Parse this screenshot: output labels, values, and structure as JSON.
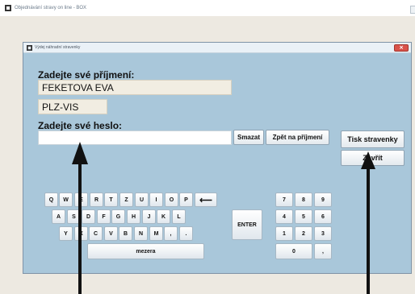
{
  "app": {
    "title": "Objednávání stravy on line - BOX"
  },
  "dialog": {
    "title": "Výdej náhradní stravenky",
    "close_glyph": "×"
  },
  "form": {
    "surname_label": "Zadejte své příjmení:",
    "surname_value": "FEKETOVA EVA",
    "department_value": "PLZ-VIS",
    "password_label": "Zadejte své heslo:",
    "password_value": ""
  },
  "buttons": {
    "clear": "Smazat",
    "back_to_surname": "Zpět na příjmení",
    "print_ticket": "Tisk stravenky",
    "close": "Zavřít"
  },
  "keyboard": {
    "row1": [
      "Q",
      "W",
      "E",
      "R",
      "T",
      "Z",
      "U",
      "I",
      "O",
      "P"
    ],
    "backspace_glyph": "⟵",
    "row2": [
      "A",
      "S",
      "D",
      "F",
      "G",
      "H",
      "J",
      "K",
      "L"
    ],
    "enter": "ENTER",
    "row3": [
      "Y",
      "X",
      "C",
      "V",
      "B",
      "N",
      "M",
      ",",
      "."
    ],
    "space": "mezera"
  },
  "numpad": {
    "keys": [
      "7",
      "8",
      "9",
      "4",
      "5",
      "6",
      "1",
      "2",
      "3"
    ],
    "zero": "0",
    "comma": ","
  }
}
